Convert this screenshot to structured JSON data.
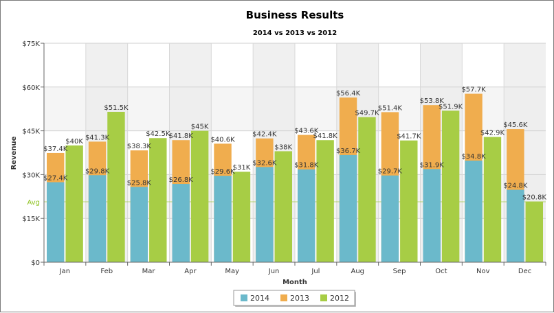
{
  "chart_data": {
    "type": "bar",
    "title": "Business Results",
    "subtitle": "2014 vs 2013 vs 2012",
    "xlabel": "Month",
    "ylabel": "Revenue",
    "ylim": [
      0,
      75000
    ],
    "yticks": [
      {
        "value": 0,
        "label": "$0"
      },
      {
        "value": 15000,
        "label": "$15K"
      },
      {
        "value": 30000,
        "label": "$30K"
      },
      {
        "value": 45000,
        "label": "$45K"
      },
      {
        "value": 60000,
        "label": "$60K"
      },
      {
        "value": 75000,
        "label": "$75K"
      }
    ],
    "avg_line": {
      "label": "Avg",
      "value": 20700,
      "color": "#8dc21f"
    },
    "grid": true,
    "legend_position": "bottom-center",
    "categories": [
      "Jan",
      "Feb",
      "Mar",
      "Apr",
      "May",
      "Jun",
      "Jul",
      "Aug",
      "Sep",
      "Oct",
      "Nov",
      "Dec"
    ],
    "series": [
      {
        "name": "2014",
        "color": "#6bb9cb",
        "values": [
          27400,
          29800,
          25800,
          26800,
          29600,
          32600,
          31800,
          36700,
          29700,
          31900,
          34800,
          24800
        ],
        "labels": [
          "$27.4K",
          "$29.8K",
          "$25.8K",
          "$26.8K",
          "$29.6K",
          "$32.6K",
          "$31.8K",
          "$36.7K",
          "$29.7K",
          "$31.9K",
          "$34.8K",
          "$24.8K"
        ]
      },
      {
        "name": "2013",
        "color": "#f0ad4e",
        "values": [
          37400,
          41300,
          38300,
          41800,
          40600,
          42400,
          43600,
          56400,
          51400,
          53800,
          57700,
          45600
        ],
        "labels": [
          "$37.4K",
          "$41.3K",
          "$38.3K",
          "$41.8K",
          "$40.6K",
          "$42.4K",
          "$43.6K",
          "$56.4K",
          "$51.4K",
          "$53.8K",
          "$57.7K",
          "$45.6K"
        ]
      },
      {
        "name": "2012",
        "color": "#a7cd45",
        "values": [
          40000,
          51500,
          42500,
          45000,
          31000,
          38000,
          41800,
          49700,
          41700,
          51900,
          42900,
          20800
        ],
        "labels": [
          "$40K",
          "$51.5K",
          "$42.5K",
          "$45K",
          "$31K",
          "$38K",
          "$41.8K",
          "$49.7K",
          "$41.7K",
          "$51.9K",
          "$42.9K",
          "$20.8K"
        ]
      }
    ]
  }
}
